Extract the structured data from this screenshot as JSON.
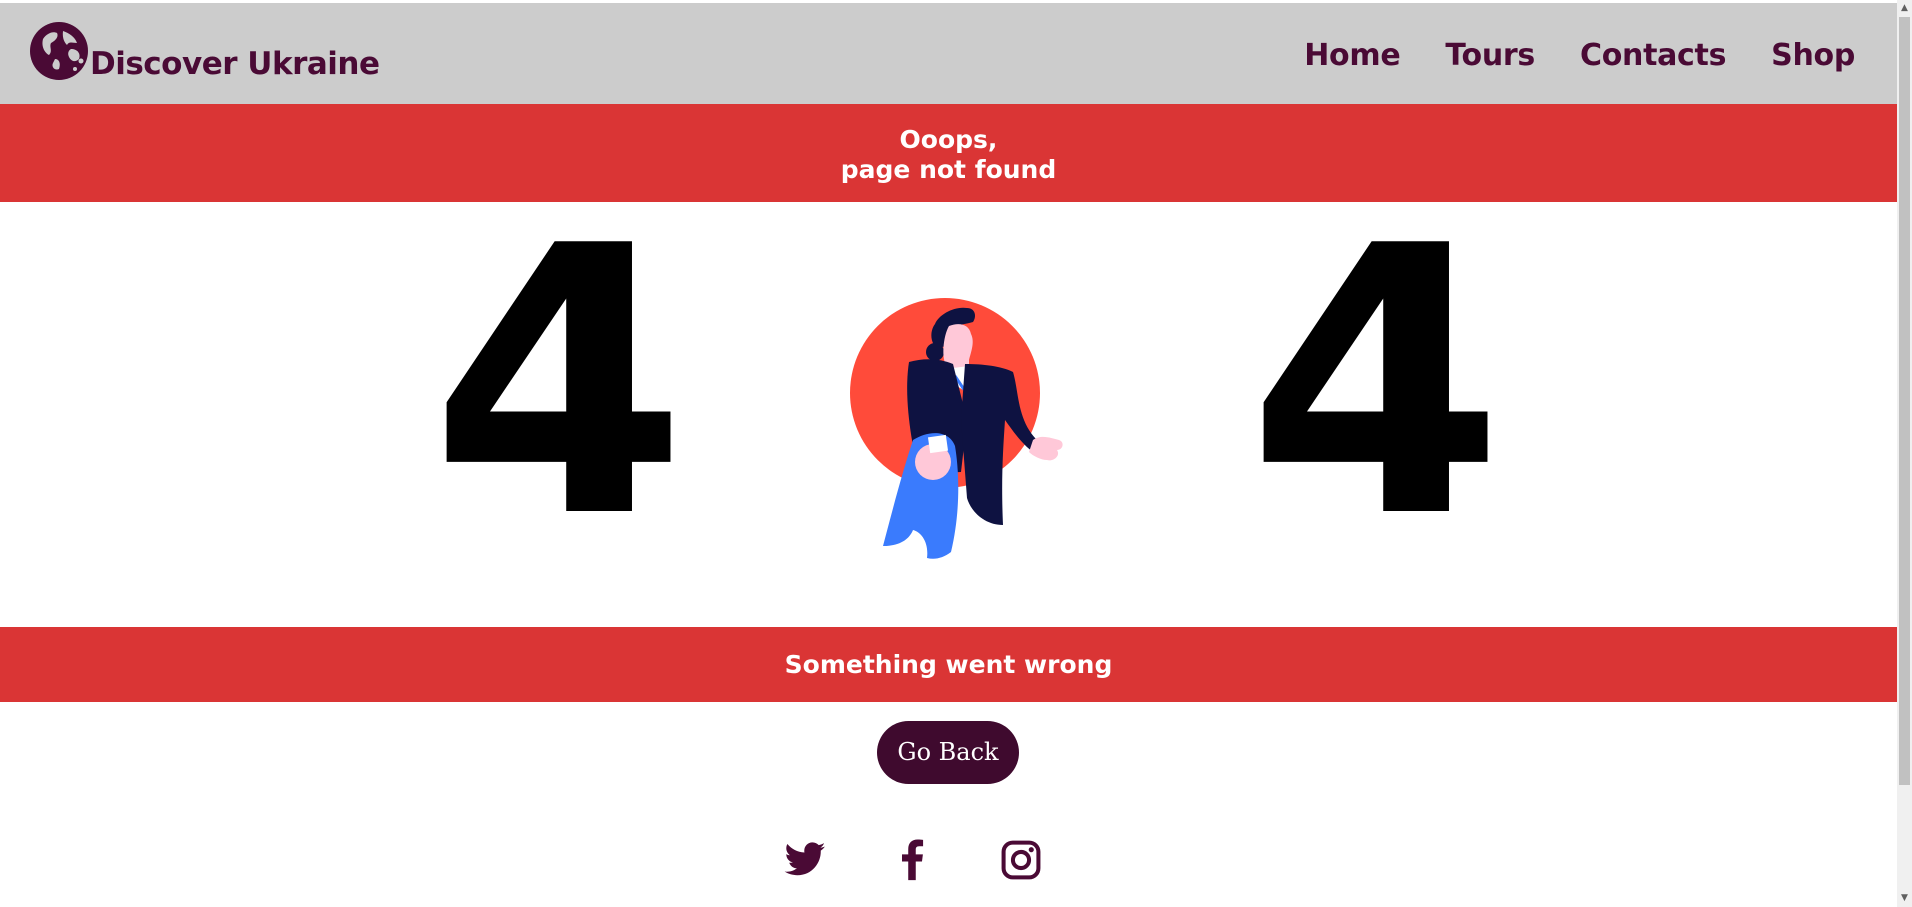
{
  "header": {
    "brand": "Discover Ukraine",
    "logo_icon": "globe-icon",
    "nav": [
      "Home",
      "Tours",
      "Contacts",
      "Shop"
    ]
  },
  "banner_top": {
    "line1": "Ooops,",
    "line2": "page not found"
  },
  "error": {
    "digit_left": "4",
    "digit_right": "4",
    "illustration": "man-in-suit-illustration"
  },
  "banner_bottom": {
    "text": "Something went wrong"
  },
  "actions": {
    "go_back": "Go Back"
  },
  "socials": [
    "twitter-icon",
    "facebook-icon",
    "instagram-icon"
  ],
  "colors": {
    "header_bg": "#cccccc",
    "brand": "#4a0a35",
    "banner": "#da3535",
    "button": "#3f0a2e",
    "illustration_circle": "#ff4b3a",
    "illustration_suit": "#0e1241",
    "illustration_cloth": "#3a7bfd"
  }
}
